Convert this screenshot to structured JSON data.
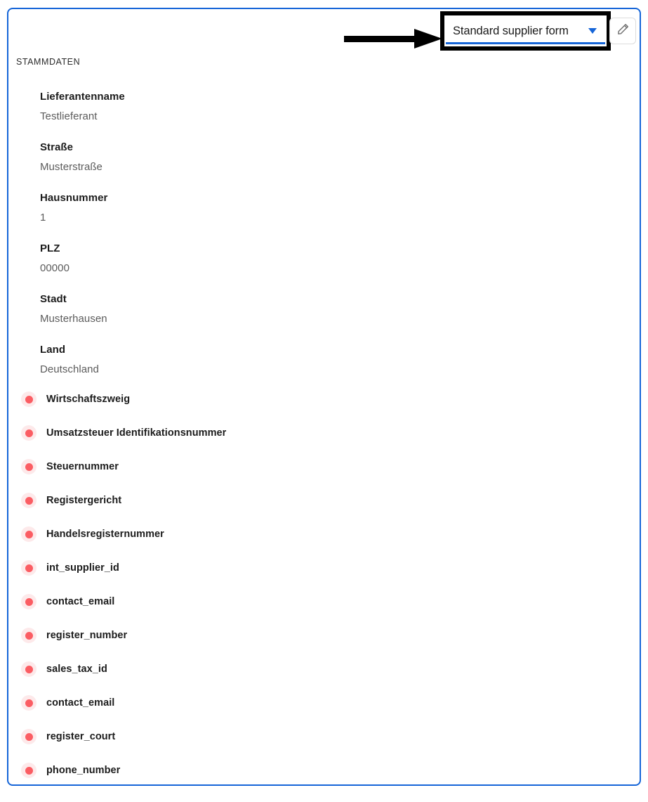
{
  "header": {
    "form_selector": {
      "selected_option": "Standard supplier form",
      "caret_icon": "chevron-down-icon",
      "highlighted": true
    },
    "edit_button": {
      "icon": "pencil-icon",
      "label": ""
    },
    "annotation": {
      "arrow_icon": "arrow-right-icon",
      "points_to": "form-selector-dropdown"
    }
  },
  "section": {
    "heading": "STAMMDATEN"
  },
  "fields": [
    {
      "label": "Lieferantenname",
      "value": "Testlieferant"
    },
    {
      "label": "Straße",
      "value": "Musterstraße"
    },
    {
      "label": "Hausnummer",
      "value": "1"
    },
    {
      "label": "PLZ",
      "value": "00000"
    },
    {
      "label": "Stadt",
      "value": "Musterhausen"
    },
    {
      "label": "Land",
      "value": "Deutschland"
    }
  ],
  "missing_fields": [
    {
      "label": "Wirtschaftszweig"
    },
    {
      "label": "Umsatzsteuer Identifikationsnummer"
    },
    {
      "label": "Steuernummer"
    },
    {
      "label": "Registergericht"
    },
    {
      "label": "Handelsregisternummer"
    },
    {
      "label": "int_supplier_id"
    },
    {
      "label": "contact_email"
    },
    {
      "label": "register_number"
    },
    {
      "label": "sales_tax_id"
    },
    {
      "label": "contact_email"
    },
    {
      "label": "register_court"
    },
    {
      "label": "phone_number"
    }
  ],
  "colors": {
    "card_border": "#1565d8",
    "accent_blue": "#1565d8",
    "missing_dot": "#fb5d63",
    "missing_dot_halo": "#fde9ea",
    "annotation_black": "#000000",
    "label_text": "#1c1c1c",
    "value_text": "#5c5c5c"
  }
}
